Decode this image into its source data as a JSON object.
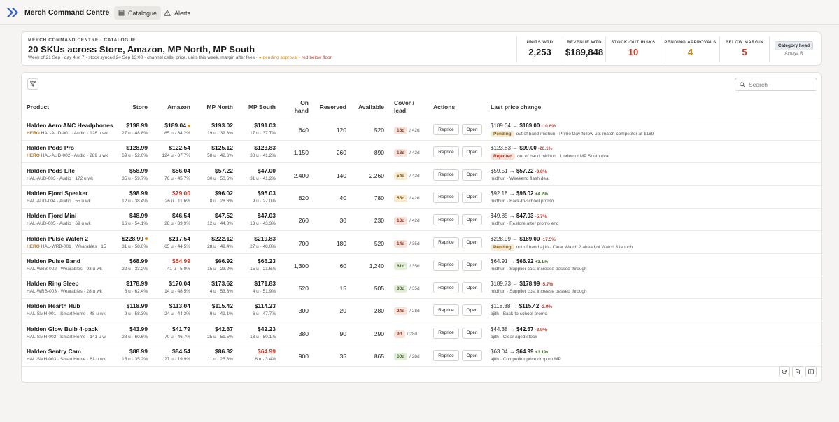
{
  "app": {
    "title": "Merch Command Centre"
  },
  "nav": {
    "tabs": [
      {
        "label": "Catalogue",
        "icon": "list-icon",
        "active": true
      },
      {
        "label": "Alerts",
        "icon": "warning-icon",
        "active": false
      }
    ]
  },
  "header": {
    "eyebrow": "MERCH COMMAND CENTRE · CATALOGUE",
    "title": "20 SKUs across Store, Amazon, MP North, MP South",
    "sub_main": "Week of 21 Sep · day 4 of 7 · stock synced 24 Sep 13:00 · channel cells: price, units this week, margin after fees · ",
    "sub_pending": "● pending approval",
    "sub_sep": " · ",
    "sub_red": "red below floor",
    "kpis": [
      {
        "label": "UNITS WTD",
        "value": "2,253",
        "color": "#1a1a1a"
      },
      {
        "label": "REVENUE WTD",
        "value": "$189,848",
        "color": "#1a1a1a"
      },
      {
        "label": "STOCK-OUT RISKS",
        "value": "10",
        "color": "#c23a2a"
      },
      {
        "label": "PENDING APPROVALS",
        "value": "4",
        "color": "#c0821a"
      },
      {
        "label": "BELOW MARGIN",
        "value": "5",
        "color": "#c23a2a"
      }
    ],
    "role": "Category head",
    "user": "Athulya R"
  },
  "toolbar": {
    "search_placeholder": "Search"
  },
  "columns": {
    "product": "Product",
    "store": "Store",
    "amazon": "Amazon",
    "mp_north": "MP North",
    "mp_south": "MP South",
    "on_hand_1": "On",
    "on_hand_2": "hand",
    "reserved": "Reserved",
    "available": "Available",
    "cover_1": "Cover /",
    "cover_2": "lead",
    "actions": "Actions",
    "last_price_change": "Last price change"
  },
  "buttons": {
    "reprice": "Reprice",
    "open": "Open"
  },
  "rows": [
    {
      "name": "Halden Aero ANC Headphones",
      "hero": "HERO",
      "meta": "HAL-AUD-001 · Audio · 128 u wk",
      "store": {
        "price": "$198.99",
        "sub": "27 u · 48.8%",
        "red": false,
        "dot": false
      },
      "amazon": {
        "price": "$189.04",
        "sub": "65 u · 34.2%",
        "red": false,
        "dot": true
      },
      "north": {
        "price": "$193.02",
        "sub": "19 u · 39.3%",
        "red": false,
        "dot": false
      },
      "south": {
        "price": "$191.03",
        "sub": "17 u · 37.7%",
        "red": false,
        "dot": false
      },
      "on_hand": "640",
      "reserved": "120",
      "available": "520",
      "cover": "18d",
      "cover_tone": "red",
      "lead": "/ 42d",
      "lpc_from": "$189.04",
      "lpc_arrow": "→",
      "lpc_to": "$169.00",
      "lpc_chg": "-10.6%",
      "lpc_chg_tone": "red",
      "lpc_status": "Pending",
      "lpc_status_tone": "pending",
      "lpc_note": "out of band midhun · Prime Day follow-up: match competitor at $169"
    },
    {
      "name": "Halden Pods Pro",
      "hero": "HERO",
      "meta": "HAL-AUD-002 · Audio · 289 u wk",
      "store": {
        "price": "$128.99",
        "sub": "69 u · 52.0%",
        "red": false,
        "dot": false
      },
      "amazon": {
        "price": "$122.54",
        "sub": "124 u · 37.7%",
        "red": false,
        "dot": false
      },
      "north": {
        "price": "$125.12",
        "sub": "58 u · 42.6%",
        "red": false,
        "dot": false
      },
      "south": {
        "price": "$123.83",
        "sub": "38 u · 41.2%",
        "red": false,
        "dot": false
      },
      "on_hand": "1,150",
      "reserved": "260",
      "available": "890",
      "cover": "13d",
      "cover_tone": "red",
      "lead": "/ 42d",
      "lpc_from": "$123.83",
      "lpc_arrow": "→",
      "lpc_to": "$99.00",
      "lpc_chg": "-20.1%",
      "lpc_chg_tone": "red",
      "lpc_status": "Rejected",
      "lpc_status_tone": "rejected",
      "lpc_note": "out of band midhun · Undercut MP South rival"
    },
    {
      "name": "Halden Pods Lite",
      "hero": "",
      "meta": "HAL-AUD-003 · Audio · 172 u wk",
      "store": {
        "price": "$58.99",
        "sub": "35 u · 59.7%",
        "red": false,
        "dot": false
      },
      "amazon": {
        "price": "$56.04",
        "sub": "76 u · 45.7%",
        "red": false,
        "dot": false
      },
      "north": {
        "price": "$57.22",
        "sub": "30 u · 50.6%",
        "red": false,
        "dot": false
      },
      "south": {
        "price": "$47.00",
        "sub": "31 u · 41.2%",
        "red": false,
        "dot": false
      },
      "on_hand": "2,400",
      "reserved": "140",
      "available": "2,260",
      "cover": "54d",
      "cover_tone": "amber",
      "lead": "/ 42d",
      "lpc_from": "$59.51",
      "lpc_arrow": "→",
      "lpc_to": "$57.22",
      "lpc_chg": "-3.8%",
      "lpc_chg_tone": "red",
      "lpc_status": "",
      "lpc_status_tone": "",
      "lpc_note": "midhun · Weekend flash deal"
    },
    {
      "name": "Halden Fjord Speaker",
      "hero": "",
      "meta": "HAL-AUD-004 · Audio · 55 u wk",
      "store": {
        "price": "$98.99",
        "sub": "12 u · 38.4%",
        "red": false,
        "dot": false
      },
      "amazon": {
        "price": "$79.00",
        "sub": "26 u · 11.6%",
        "red": true,
        "dot": false
      },
      "north": {
        "price": "$96.02",
        "sub": "8 u · 28.6%",
        "red": false,
        "dot": false
      },
      "south": {
        "price": "$95.03",
        "sub": "9 u · 27.0%",
        "red": false,
        "dot": false
      },
      "on_hand": "820",
      "reserved": "40",
      "available": "780",
      "cover": "55d",
      "cover_tone": "amber",
      "lead": "/ 42d",
      "lpc_from": "$92.18",
      "lpc_arrow": "→",
      "lpc_to": "$96.02",
      "lpc_chg": "+4.2%",
      "lpc_chg_tone": "green",
      "lpc_status": "",
      "lpc_status_tone": "",
      "lpc_note": "midhun · Back-to-school promo"
    },
    {
      "name": "Halden Fjord Mini",
      "hero": "",
      "meta": "HAL-AUD-005 · Audio · 69 u wk",
      "store": {
        "price": "$48.99",
        "sub": "16 u · 54.1%",
        "red": false,
        "dot": false
      },
      "amazon": {
        "price": "$46.54",
        "sub": "28 u · 39.9%",
        "red": false,
        "dot": false
      },
      "north": {
        "price": "$47.52",
        "sub": "12 u · 44.8%",
        "red": false,
        "dot": false
      },
      "south": {
        "price": "$47.03",
        "sub": "13 u · 43.3%",
        "red": false,
        "dot": false
      },
      "on_hand": "260",
      "reserved": "30",
      "available": "230",
      "cover": "13d",
      "cover_tone": "red",
      "lead": "/ 42d",
      "lpc_from": "$49.85",
      "lpc_arrow": "→",
      "lpc_to": "$47.03",
      "lpc_chg": "-5.7%",
      "lpc_chg_tone": "red",
      "lpc_status": "",
      "lpc_status_tone": "",
      "lpc_note": "midhun · Restore after promo end"
    },
    {
      "name": "Halden Pulse Watch 2",
      "hero": "HERO",
      "meta": "HAL-WRB-001 · Wearables · 15",
      "store": {
        "price": "$228.99",
        "sub": "31 u · 58.6%",
        "red": false,
        "dot": true
      },
      "amazon": {
        "price": "$217.54",
        "sub": "65 u · 44.5%",
        "red": false,
        "dot": false
      },
      "north": {
        "price": "$222.12",
        "sub": "28 u · 49.4%",
        "red": false,
        "dot": false
      },
      "south": {
        "price": "$219.83",
        "sub": "27 u · 48.0%",
        "red": false,
        "dot": false
      },
      "on_hand": "700",
      "reserved": "180",
      "available": "520",
      "cover": "14d",
      "cover_tone": "red",
      "lead": "/ 35d",
      "lpc_from": "$228.99",
      "lpc_arrow": "→",
      "lpc_to": "$189.00",
      "lpc_chg": "-17.5%",
      "lpc_chg_tone": "red",
      "lpc_status": "Pending",
      "lpc_status_tone": "pending",
      "lpc_note": "out of band ajith · Clear Watch 2 ahead of Watch 3 launch"
    },
    {
      "name": "Halden Pulse Band",
      "hero": "",
      "meta": "HAL-WRB-002 · Wearables · 93 u wk",
      "store": {
        "price": "$68.99",
        "sub": "22 u · 33.2%",
        "red": false,
        "dot": false
      },
      "amazon": {
        "price": "$54.99",
        "sub": "41 u · 5.0%",
        "red": true,
        "dot": false
      },
      "north": {
        "price": "$66.92",
        "sub": "15 u · 23.2%",
        "red": false,
        "dot": false
      },
      "south": {
        "price": "$66.23",
        "sub": "15 u · 21.6%",
        "red": false,
        "dot": false
      },
      "on_hand": "1,300",
      "reserved": "60",
      "available": "1,240",
      "cover": "61d",
      "cover_tone": "green",
      "lead": "/ 35d",
      "lpc_from": "$64.91",
      "lpc_arrow": "→",
      "lpc_to": "$66.92",
      "lpc_chg": "+3.1%",
      "lpc_chg_tone": "green",
      "lpc_status": "",
      "lpc_status_tone": "",
      "lpc_note": "midhun · Supplier cost increase passed through"
    },
    {
      "name": "Halden Ring Sleep",
      "hero": "",
      "meta": "HAL-WRB-003 · Wearables · 28 u wk",
      "store": {
        "price": "$178.99",
        "sub": "6 u · 62.4%",
        "red": false,
        "dot": false
      },
      "amazon": {
        "price": "$170.04",
        "sub": "14 u · 48.5%",
        "red": false,
        "dot": false
      },
      "north": {
        "price": "$173.62",
        "sub": "4 u · 53.3%",
        "red": false,
        "dot": false
      },
      "south": {
        "price": "$171.83",
        "sub": "4 u · 51.9%",
        "red": false,
        "dot": false
      },
      "on_hand": "520",
      "reserved": "15",
      "available": "505",
      "cover": "80d",
      "cover_tone": "green",
      "lead": "/ 35d",
      "lpc_from": "$189.73",
      "lpc_arrow": "→",
      "lpc_to": "$178.99",
      "lpc_chg": "-5.7%",
      "lpc_chg_tone": "red",
      "lpc_status": "",
      "lpc_status_tone": "",
      "lpc_note": "midhun · Supplier cost increase passed through"
    },
    {
      "name": "Halden Hearth Hub",
      "hero": "",
      "meta": "HAL-SMH-001 · Smart Home · 48 u wk",
      "store": {
        "price": "$118.99",
        "sub": "9 u · 58.3%",
        "red": false,
        "dot": false
      },
      "amazon": {
        "price": "$113.04",
        "sub": "24 u · 44.3%",
        "red": false,
        "dot": false
      },
      "north": {
        "price": "$115.42",
        "sub": "9 u · 49.1%",
        "red": false,
        "dot": false
      },
      "south": {
        "price": "$114.23",
        "sub": "6 u · 47.7%",
        "red": false,
        "dot": false
      },
      "on_hand": "300",
      "reserved": "20",
      "available": "280",
      "cover": "24d",
      "cover_tone": "red",
      "lead": "/ 28d",
      "lpc_from": "$118.88",
      "lpc_arrow": "→",
      "lpc_to": "$115.42",
      "lpc_chg": "-2.9%",
      "lpc_chg_tone": "red",
      "lpc_status": "",
      "lpc_status_tone": "",
      "lpc_note": "ajith · Back-to-school promo"
    },
    {
      "name": "Halden Glow Bulb 4-pack",
      "hero": "",
      "meta": "HAL-SMH-002 · Smart Home · 141 u w",
      "store": {
        "price": "$43.99",
        "sub": "28 u · 60.6%",
        "red": false,
        "dot": false
      },
      "amazon": {
        "price": "$41.79",
        "sub": "70 u · 46.7%",
        "red": false,
        "dot": false
      },
      "north": {
        "price": "$42.67",
        "sub": "25 u · 51.5%",
        "red": false,
        "dot": false
      },
      "south": {
        "price": "$42.23",
        "sub": "18 u · 50.1%",
        "red": false,
        "dot": false
      },
      "on_hand": "380",
      "reserved": "90",
      "available": "290",
      "cover": "9d",
      "cover_tone": "red",
      "lead": "/ 28d",
      "lpc_from": "$44.38",
      "lpc_arrow": "→",
      "lpc_to": "$42.67",
      "lpc_chg": "-3.9%",
      "lpc_chg_tone": "red",
      "lpc_status": "",
      "lpc_status_tone": "",
      "lpc_note": "ajith · Clear aged stock"
    },
    {
      "name": "Halden Sentry Cam",
      "hero": "",
      "meta": "HAL-SMH-003 · Smart Home · 61 u wk",
      "store": {
        "price": "$88.99",
        "sub": "15 u · 35.2%",
        "red": false,
        "dot": false
      },
      "amazon": {
        "price": "$84.54",
        "sub": "27 u · 19.9%",
        "red": false,
        "dot": false
      },
      "north": {
        "price": "$86.32",
        "sub": "11 u · 25.3%",
        "red": false,
        "dot": false
      },
      "south": {
        "price": "$64.99",
        "sub": "8 u · 3.4%",
        "red": true,
        "dot": false
      },
      "on_hand": "900",
      "reserved": "35",
      "available": "865",
      "cover": "60d",
      "cover_tone": "green",
      "lead": "/ 28d",
      "lpc_from": "$63.04",
      "lpc_arrow": "→",
      "lpc_to": "$64.99",
      "lpc_chg": "+3.1%",
      "lpc_chg_tone": "green",
      "lpc_status": "",
      "lpc_status_tone": "",
      "lpc_note": "ajith · Competitor price drop on MP"
    }
  ]
}
